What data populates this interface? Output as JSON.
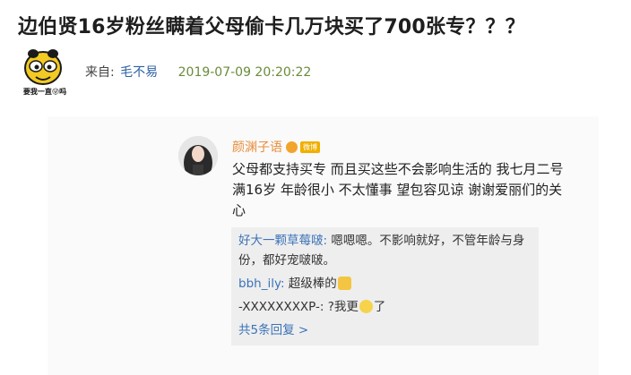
{
  "post": {
    "title": "边伯贤16岁粉丝瞒着父母偷卡几万块买了700张专？？？",
    "source_label": "来自:",
    "author": "毛不易",
    "timestamp": "2019-07-09 20:20:22",
    "avatar_caption": "要我一直😜吗"
  },
  "comment": {
    "name": "颜渊子语",
    "badge": "微博",
    "text": "父母都支持买专 而且买这些不会影响生活的 我七月二号满16岁 年龄很小 不太懂事 望包容见谅 谢谢爱丽们的关心"
  },
  "replies": [
    {
      "user": "好大一颗草莓啵:",
      "text": " 嗯嗯嗯。不影响就好，不管年龄与身份，都好宠啵啵。"
    },
    {
      "user": "bbh_ily:",
      "text": " 超级棒的",
      "emoji": "thumbs-up-emoji"
    },
    {
      "user": "-XXXXXXXXP-:",
      "text_before": " ?我更",
      "emoji": "face-emoji",
      "text_after": "了"
    }
  ],
  "more_replies": "共5条回复 >",
  "colors": {
    "author_link": "#2c62a5",
    "timestamp": "#6a8b3a",
    "commenter_name": "#e98d3a",
    "reply_user": "#3b73b8",
    "reply_background": "#eeeeee"
  }
}
